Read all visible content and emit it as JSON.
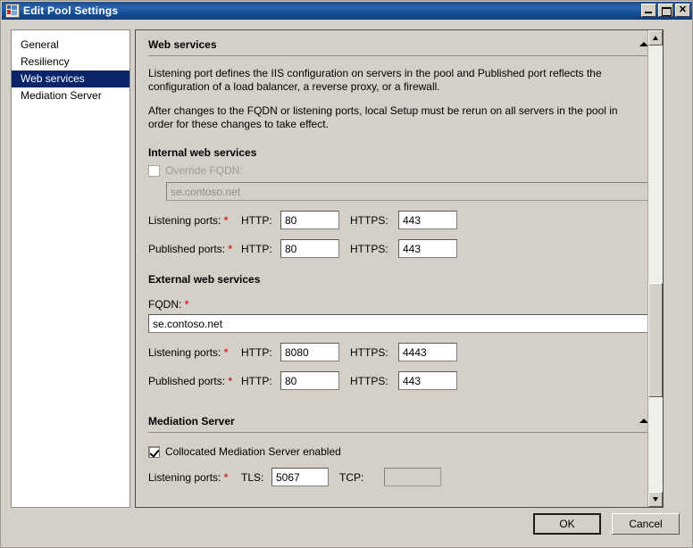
{
  "window": {
    "title": "Edit Pool Settings",
    "icon": "pool-settings-icon",
    "controls": {
      "minimize": "–",
      "maximize": "□",
      "close": "✕"
    }
  },
  "sidebar": {
    "items": [
      {
        "label": "General",
        "selected": false
      },
      {
        "label": "Resiliency",
        "selected": false
      },
      {
        "label": "Web services",
        "selected": true
      },
      {
        "label": "Mediation Server",
        "selected": false
      }
    ]
  },
  "web_services": {
    "header": "Web services",
    "collapse_arrow": "chevron-up-icon",
    "paragraph1": "Listening port defines the IIS configuration on servers in the pool and Published port reflects the configuration of a load balancer, a reverse proxy, or a firewall.",
    "paragraph2": "After changes to the FQDN or listening ports, local Setup must be rerun on all servers in the pool in order for these changes to take effect.",
    "internal": {
      "heading": "Internal web services",
      "override_fqdn_label": "Override FQDN:",
      "override_fqdn_checked": false,
      "override_fqdn_enabled": false,
      "fqdn_value": "se.contoso.net",
      "fqdn_enabled": false,
      "listening": {
        "label": "Listening ports:",
        "required": "*",
        "http_label": "HTTP:",
        "http_value": "80",
        "https_label": "HTTPS:",
        "https_value": "443"
      },
      "published": {
        "label": "Published ports:",
        "required": "*",
        "http_label": "HTTP:",
        "http_value": "80",
        "https_label": "HTTPS:",
        "https_value": "443"
      }
    },
    "external": {
      "heading": "External web services",
      "fqdn_label": "FQDN:",
      "fqdn_required": "*",
      "fqdn_value": "se.contoso.net",
      "listening": {
        "label": "Listening ports:",
        "required": "*",
        "http_label": "HTTP:",
        "http_value": "8080",
        "https_label": "HTTPS:",
        "https_value": "4443"
      },
      "published": {
        "label": "Published ports:",
        "required": "*",
        "http_label": "HTTP:",
        "http_value": "80",
        "https_label": "HTTPS:",
        "https_value": "443"
      }
    }
  },
  "mediation_server": {
    "header": "Mediation Server",
    "collapse_arrow": "chevron-up-icon",
    "collocated_label": "Collocated Mediation Server enabled",
    "collocated_checked": true,
    "listening": {
      "label": "Listening ports:",
      "required": "*",
      "tls_label": "TLS:",
      "tls_value": "5067",
      "tcp_label": "TCP:",
      "tcp_value": "",
      "tcp_enabled": false
    }
  },
  "footer": {
    "ok_label": "OK",
    "cancel_label": "Cancel"
  },
  "colors": {
    "titlebar": "#1d4d8f",
    "selection": "#0a246a",
    "dialog_face": "#d4d0c8",
    "required_asterisk": "#cc3333"
  }
}
